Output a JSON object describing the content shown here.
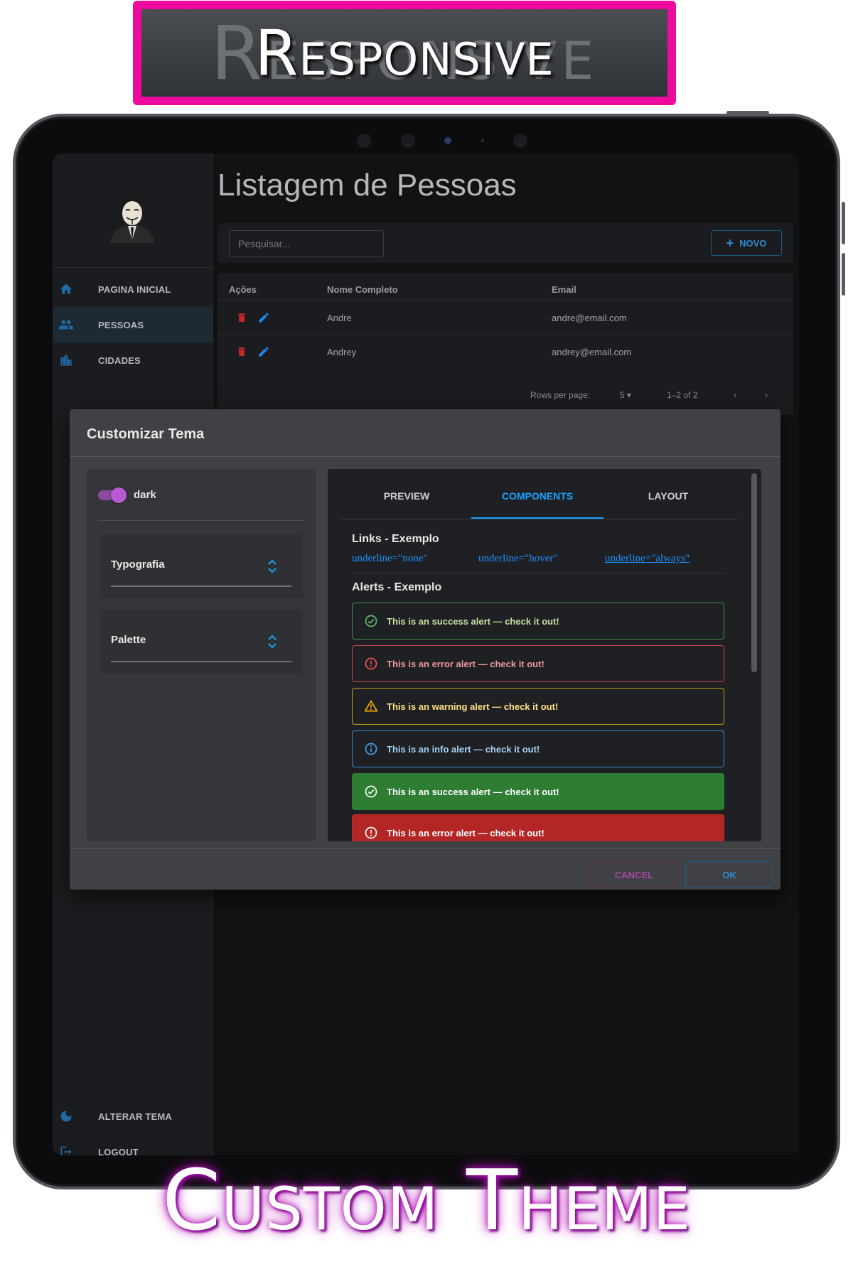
{
  "banner": {
    "title": "Responsive",
    "ghost_text": "Responsive"
  },
  "caption": "Custom Theme",
  "sidebar": {
    "items": [
      {
        "label": "PAGINA INICIAL",
        "icon": "home-icon",
        "active": false
      },
      {
        "label": "PESSOAS",
        "icon": "people-icon",
        "active": true
      },
      {
        "label": "CIDADES",
        "icon": "city-icon",
        "active": false
      }
    ],
    "bottom_items": [
      {
        "label": "ALTERAR TEMA",
        "icon": "moon-icon"
      },
      {
        "label": "LOGOUT",
        "icon": "logout-icon"
      }
    ]
  },
  "main": {
    "title": "Listagem de Pessoas",
    "search_placeholder": "Pesquisar...",
    "new_button": "NOVO",
    "table": {
      "headers": [
        "Ações",
        "Nome Completo",
        "Email"
      ],
      "rows": [
        {
          "name": "Andre",
          "email": "andre@email.com"
        },
        {
          "name": "Andrey",
          "email": "andrey@email.com"
        }
      ],
      "rows_per_page_label": "Rows per page:",
      "rows_per_page_value": "5",
      "range": "1–2 of 2"
    }
  },
  "dialog": {
    "title": "Customizar Tema",
    "toggle_label": "dark",
    "toggle_on": true,
    "selects": [
      {
        "label": "Typografia"
      },
      {
        "label": "Palette"
      }
    ],
    "tabs": [
      {
        "label": "PREVIEW",
        "active": false
      },
      {
        "label": "COMPONENTS",
        "active": true
      },
      {
        "label": "LAYOUT",
        "active": false
      }
    ],
    "links_title": "Links - Exemplo",
    "links": [
      "underline=\"none\"",
      "underline=\"hover\"",
      "underline=\"always\""
    ],
    "alerts_title": "Alerts - Exemplo",
    "alerts": [
      {
        "text": "This is an success alert — check it out!",
        "severity": "success",
        "variant": "outlined",
        "icon": "check-circle-icon",
        "color": "#2e7d32",
        "text_color": "#c5e1a5"
      },
      {
        "text": "This is an error alert — check it out!",
        "severity": "error",
        "variant": "outlined",
        "icon": "error-icon",
        "color": "#c62828",
        "text_color": "#ef9a9a"
      },
      {
        "text": "This is an warning alert — check it out!",
        "severity": "warning",
        "variant": "outlined",
        "icon": "warning-icon",
        "color": "#c79a1e",
        "text_color": "#ffe082"
      },
      {
        "text": "This is an info alert — check it out!",
        "severity": "info",
        "variant": "outlined",
        "icon": "info-icon",
        "color": "#1e88e5",
        "text_color": "#a7d3f7"
      },
      {
        "text": "This is an success alert — check it out!",
        "severity": "success",
        "variant": "filled",
        "icon": "check-circle-icon",
        "color": "#2e7d32",
        "text_color": "#ffffff"
      },
      {
        "text": "This is an error alert — check it out!",
        "severity": "error",
        "variant": "filled",
        "icon": "error-icon",
        "color": "#c62828",
        "text_color": "#ffffff"
      }
    ],
    "cancel_label": "CANCEL",
    "ok_label": "OK"
  },
  "colors": {
    "accent": "#1aa2ff",
    "toggle": "#b95ad5",
    "banner_frame": "#ee0a9f",
    "caption_glow": "#b20fb6"
  }
}
